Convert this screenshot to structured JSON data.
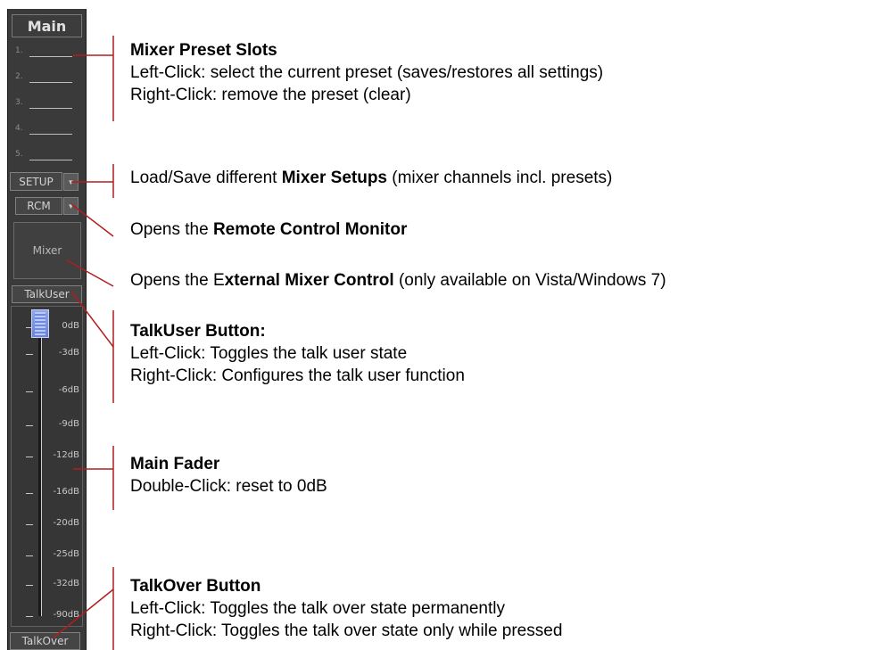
{
  "mixer_strip": {
    "title": "Main",
    "preset_slots": [
      "1.",
      "2.",
      "3.",
      "4.",
      "5."
    ],
    "setup_label": "SETUP",
    "rcm_label": "RCM",
    "mixer_label": "Mixer",
    "talkuser_label": "TalkUser",
    "talkover_label": "TalkOver",
    "fader_scale": [
      "0dB",
      "-3dB",
      "-6dB",
      "-9dB",
      "-12dB",
      "-16dB",
      "-20dB",
      "-25dB",
      "-32dB",
      "-90dB"
    ],
    "fader_value_db": 0
  },
  "annotations": {
    "presets": {
      "title": "Mixer Preset Slots",
      "line1": "Left-Click: select the current preset (saves/restores all settings)",
      "line2": "Right-Click: remove the preset (clear)"
    },
    "setup": {
      "prefix": "Load/Save different ",
      "bold": "Mixer Setups",
      "suffix": " (mixer channels incl. presets)"
    },
    "rcm": {
      "prefix": "Opens the ",
      "bold": "Remote Control Monitor"
    },
    "external": {
      "prefix": "Opens the E",
      "bold": "xternal Mixer Control",
      "suffix": " (only available on Vista/Windows 7)"
    },
    "talkuser": {
      "title": "TalkUser Button:",
      "line1": "Left-Click: Toggles the talk user state",
      "line2": "Right-Click: Configures the talk user function"
    },
    "fader": {
      "title": "Main Fader",
      "line1": "Double-Click: reset to 0dB"
    },
    "talkover": {
      "title": "TalkOver Button",
      "line1": "Left-Click: Toggles the talk over state permanently",
      "line2": "Right-Click: Toggles the talk over state only while pressed"
    }
  },
  "colors": {
    "strip_bg": "#3a3a3a",
    "callout_line": "#b01e1e",
    "fader_knob": "#7b93e0"
  }
}
